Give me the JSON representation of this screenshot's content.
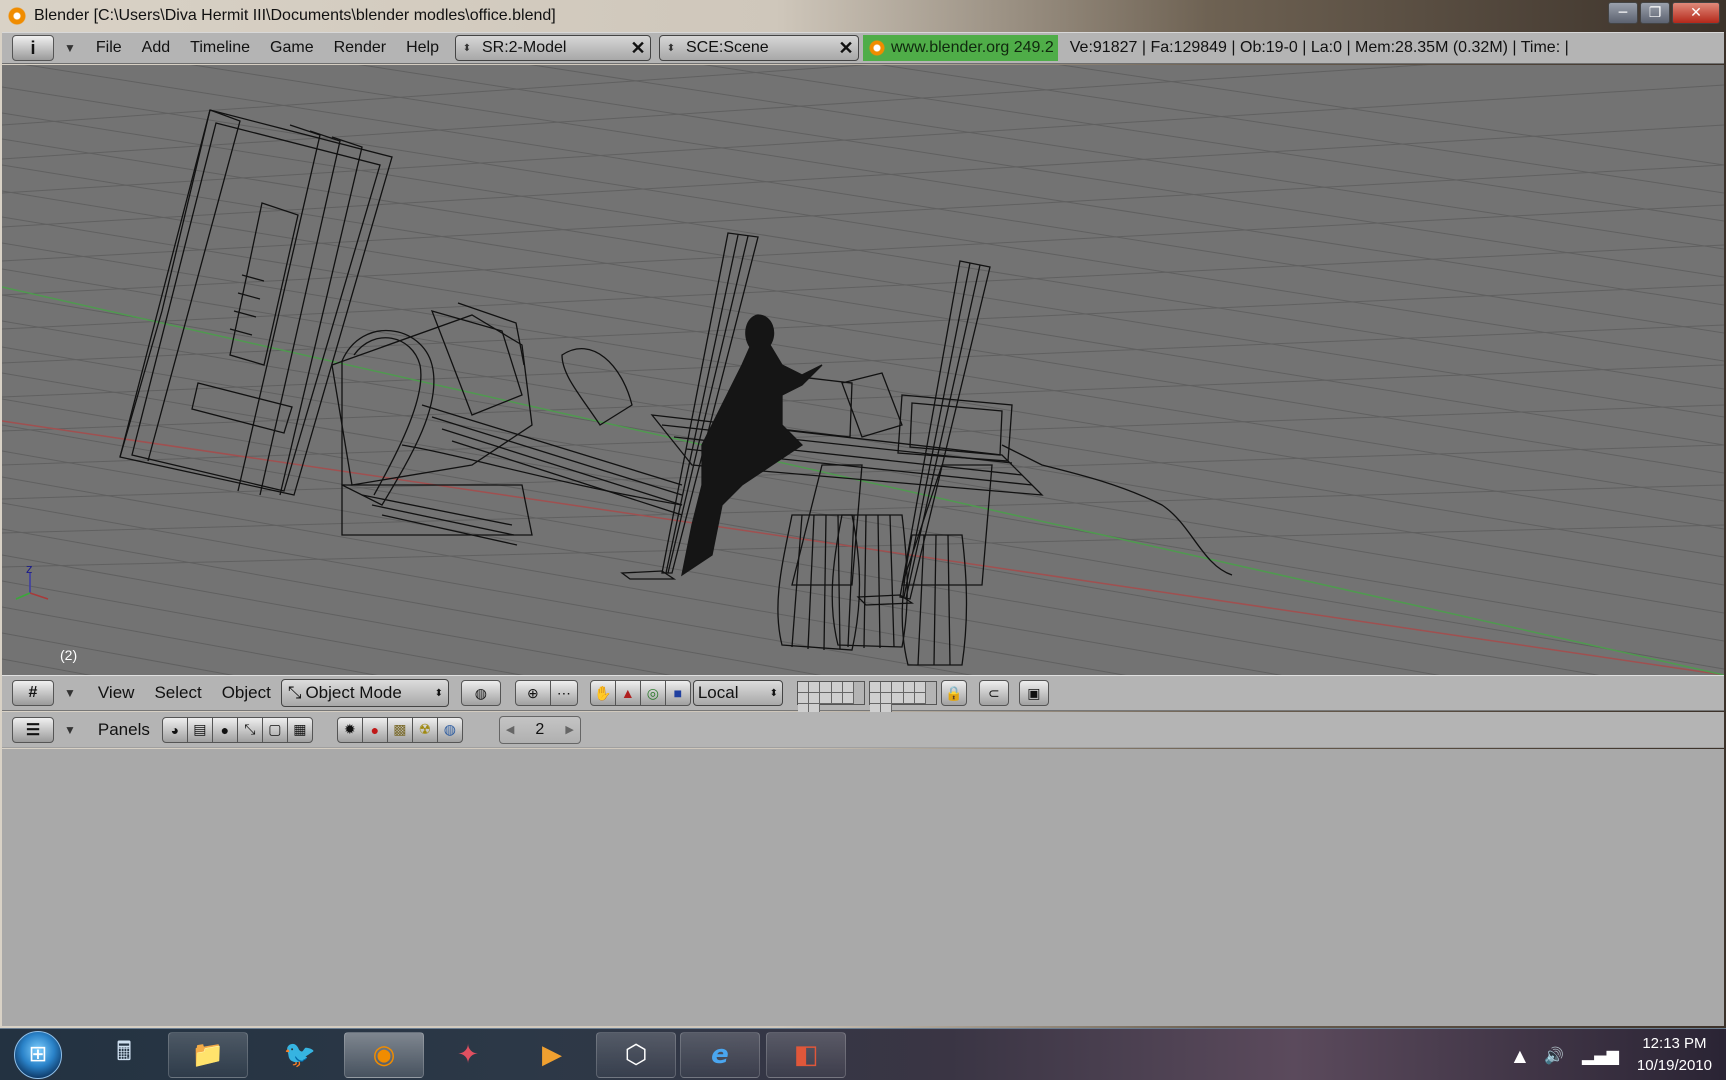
{
  "window": {
    "title": "Blender [C:\\Users\\Diva Hermit III\\Documents\\blender modles\\office.blend]",
    "minimize": "─",
    "maximize": "❐",
    "close": "✕"
  },
  "info_header": {
    "menus": [
      "File",
      "Add",
      "Timeline",
      "Game",
      "Render",
      "Help"
    ],
    "screen_value": "SR:2-Model",
    "scene_value": "SCE:Scene",
    "link": "www.blender.org 249.2",
    "stats": "Ve:91827 | Fa:129849 | Ob:19-0 | La:0  | Mem:28.35M (0.32M)  | Time: |"
  },
  "viewport": {
    "frame_number": "(2)",
    "axis_z_label": "z",
    "background_color": "#737373",
    "wire_color": "#111111",
    "x_axis_color": "#a05050",
    "y_axis_color": "#4f9a4f"
  },
  "view_header": {
    "menus": [
      "View",
      "Select",
      "Object"
    ],
    "mode": "Object Mode",
    "orientation": "Local"
  },
  "panels_header": {
    "label": "Panels",
    "frame_field": "2"
  },
  "taskbar": {
    "clock_time": "12:13 PM",
    "clock_date": "10/19/2010",
    "apps": [
      {
        "name": "calculator-icon",
        "glyph": "🖩"
      },
      {
        "name": "explorer-icon",
        "glyph": "📁"
      },
      {
        "name": "bird-icon",
        "glyph": "🐦"
      },
      {
        "name": "blender-icon",
        "glyph": "◉"
      },
      {
        "name": "autodesk-icon",
        "glyph": "✦"
      },
      {
        "name": "media-player-icon",
        "glyph": "▶"
      },
      {
        "name": "unity-icon",
        "glyph": "⬡"
      },
      {
        "name": "internet-explorer-icon",
        "glyph": "e"
      },
      {
        "name": "powerpoint-icon",
        "glyph": "◧"
      }
    ]
  }
}
